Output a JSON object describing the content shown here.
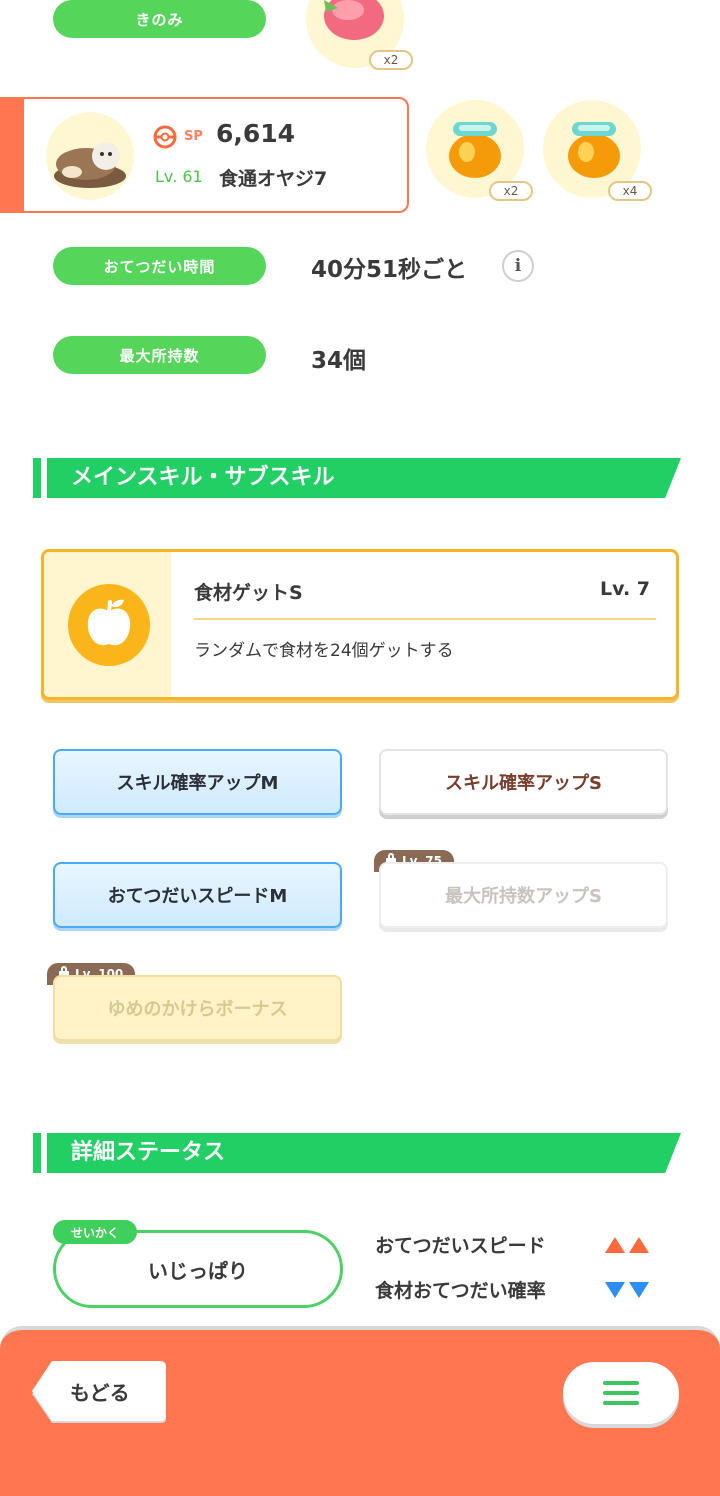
{
  "berries": {
    "label": "きのみ",
    "qty": "x2"
  },
  "pokemon": {
    "sp_label": "SP",
    "strength": "6,614",
    "level": "Lv. 61",
    "name": "食通オヤジ7"
  },
  "ingredients": [
    {
      "qty": "x2"
    },
    {
      "qty": "x4"
    }
  ],
  "help_time": {
    "label": "おてつだい時間",
    "value": "40分51秒ごと"
  },
  "max_carry": {
    "label": "最大所持数",
    "value": "34個"
  },
  "skills_section": {
    "title": "メインスキル・サブスキル"
  },
  "main_skill": {
    "name": "食材ゲットS",
    "level": "Lv. 7",
    "description": "ランダムで食材を24個ゲットする"
  },
  "sub_skills": [
    {
      "label": "スキル確率アップM"
    },
    {
      "label": "スキル確率アップS"
    },
    {
      "label": "おてつだいスピードM"
    },
    {
      "label": "最大所持数アップS",
      "lock": "Lv. 75"
    },
    {
      "label": "ゆめのかけらボーナス",
      "lock": "Lv. 100"
    }
  ],
  "detail_section": {
    "title": "詳細ステータス"
  },
  "nature": {
    "tag": "せいかく",
    "value": "いじっぱり",
    "up_label": "おてつだいスピード",
    "down_label": "食材おてつだい確率",
    "up_color": "#ff6a3d",
    "down_color": "#2e8df0"
  },
  "footer": {
    "back_label": "もどる",
    "menu_icon": "hamburger-icon"
  }
}
